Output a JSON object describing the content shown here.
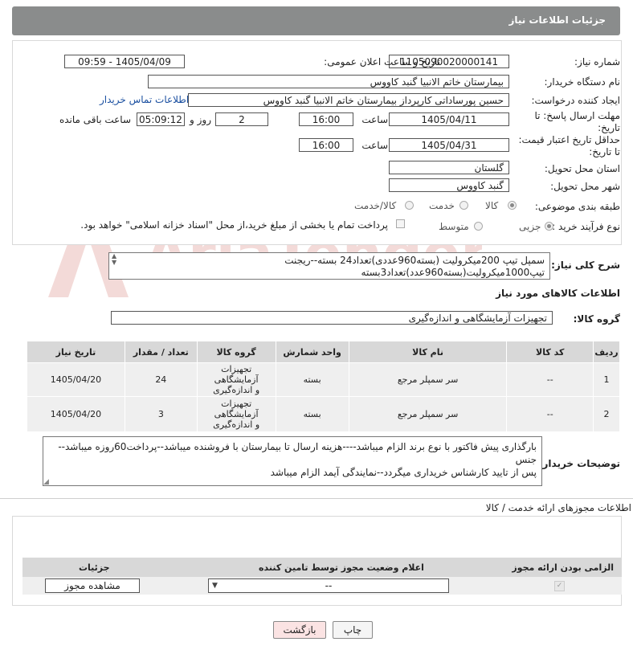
{
  "header": {
    "title": "جزئیات اطلاعات نیاز"
  },
  "form": {
    "need_number_label": "شماره نیاز:",
    "need_number": "1105090020000141",
    "announce_label": "تاریخ و ساعت اعلان عمومی:",
    "announce_value": "1405/04/09 - 09:59",
    "buyer_label": "نام دستگاه خریدار:",
    "buyer_value": "بیمارستان خاتم الانبیا گنبد کاووس",
    "creator_label": "ایجاد کننده درخواست:",
    "creator_value": "حسین پورساداتی کارپرداز بیمارستان خاتم الانبیا گنبد کاووس",
    "contact_link": "اطلاعات تماس خریدار",
    "deadline_label": "مهلت ارسال پاسخ: تا تاریخ:",
    "deadline_date": "1405/04/11",
    "time_label": "ساعت",
    "deadline_time": "16:00",
    "days_value": "2",
    "days_label": "روز و",
    "remaining_time": "05:09:12",
    "remaining_label": "ساعت باقی مانده",
    "price_validity_label": "حداقل تاریخ اعتبار قیمت: تا تاریخ:",
    "price_date": "1405/04/31",
    "price_time": "16:00",
    "province_label": "استان محل تحویل:",
    "province_value": "گلستان",
    "city_label": "شهر محل تحویل:",
    "city_value": "گنبد کاووس",
    "category_label": "طبقه بندی موضوعی:",
    "category_options": [
      "کالا",
      "خدمت",
      "کالا/خدمت"
    ],
    "category_selected": "کالا",
    "process_label": "نوع فرآیند خرید :",
    "process_options": [
      "جزیی",
      "متوسط"
    ],
    "process_selected": "جزیی",
    "payment_note": "پرداخت تمام یا بخشی از مبلغ خرید،از محل \"اسناد خزانه اسلامی\" خواهد بود."
  },
  "description": {
    "label": "شرح کلی نیاز:",
    "line1": "سمپل تیپ 200میکرولیت (بسته960عددی)تعداد24 بسته--ریجنت",
    "line2": "تیپ1000میکرولیت(بسته960عدد)تعداد3بسته"
  },
  "goods": {
    "section_title": "اطلاعات کالاهای مورد نیاز",
    "group_label": "گروه کالا:",
    "group_value": "تجهیزات آزمایشگاهی و اندازه‌گیری",
    "columns": [
      "ردیف",
      "کد کالا",
      "نام کالا",
      "واحد شمارش",
      "گروه کالا",
      "تعداد / مقدار",
      "تاریخ نیاز"
    ],
    "rows": [
      {
        "row": "1",
        "code": "--",
        "name": "سر سمپلر مرجع",
        "unit": "بسته",
        "group": "تجهیزات آزمایشگاهی و اندازه‌گیری",
        "qty": "24",
        "date": "1405/04/20"
      },
      {
        "row": "2",
        "code": "--",
        "name": "سر سمپلر مرجع",
        "unit": "بسته",
        "group": "تجهیزات آزمایشگاهی و اندازه‌گیری",
        "qty": "3",
        "date": "1405/04/20"
      }
    ]
  },
  "buyer_notes": {
    "label": "توضیحات خریدار:",
    "line1": "بارگذاری پیش فاکتور با نوع برند الزام میباشد----هزینه ارسال تا بیمارستان با فروشنده میباشد--پرداخت60روزه میباشد--جنس",
    "line2": "پس از تایید کارشناس خریداری میگردد--نمایندگی آیمد الزام میباشد"
  },
  "permits": {
    "section_title": "اطلاعات مجوزهای ارائه خدمت / کالا",
    "col_required": "الزامی بودن ارائه مجوز",
    "col_status": "اعلام وضعیت مجوز توسط تامین کننده",
    "col_details": "جزئیات",
    "status_value": "--",
    "view_button": "مشاهده مجوز"
  },
  "footer": {
    "print_button": "چاپ",
    "back_button": "بازگشت"
  },
  "watermark": {
    "text": "AriaTender.net"
  }
}
